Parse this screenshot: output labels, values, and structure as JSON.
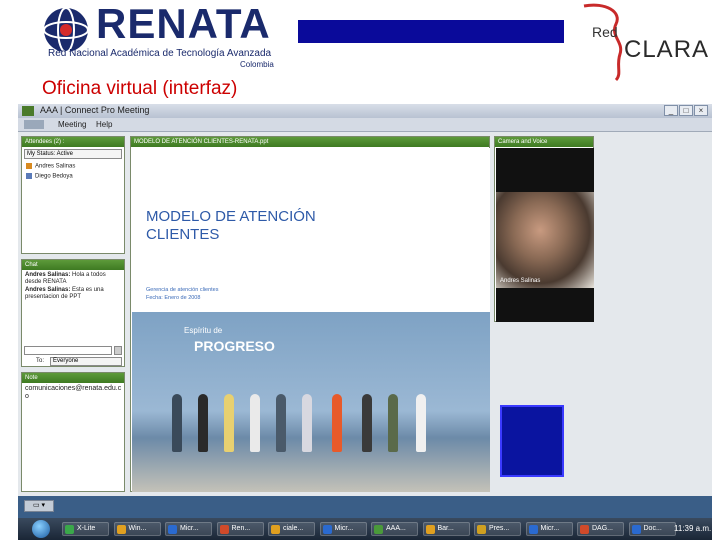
{
  "header": {
    "renata_name": "RENATA",
    "renata_subtitle": "Red Nacional Académica de Tecnología Avanzada",
    "renata_country": "Colombia",
    "redclara_red": "Red",
    "redclara_name": "CLARA",
    "title": "Oficina virtual (interfaz)",
    "colors": {
      "renata_blue": "#1a2a6c",
      "title_red": "#cc0000",
      "bar_blue": "#0a0a9a"
    }
  },
  "app": {
    "window_title": "AAA | Connect Pro Meeting",
    "menus": [
      "Meeting",
      "Help"
    ],
    "attendees": {
      "title": "Attendees (2) :",
      "status": "My Status: Active",
      "list": [
        "Andres Salinas",
        "Diego Bedoya"
      ]
    },
    "share": {
      "title": "MODELO DE ATENCIÓN CLIENTES-RENATA.ppt"
    },
    "camera": {
      "title": "Camera and Voice",
      "speaker": "Andres Salinas"
    },
    "chat": {
      "title": "Chat",
      "messages": [
        {
          "author": "Andres Salinas:",
          "text": "Hola a todos desde RENATA"
        },
        {
          "author": "Andres Salinas:",
          "text": "Esta es una presentacion de PPT"
        }
      ],
      "to_label": "To:",
      "to_value": "Everyone"
    },
    "note": {
      "title": "Note",
      "text": "comunicaciones@renata.edu.co"
    }
  },
  "slide": {
    "heading_line1": "MODELO DE ATENCIÓN",
    "heading_line2": "CLIENTES",
    "meta_line1": "Gerencia de atención clientes",
    "meta_line2": "Fecha: Enero de 2008",
    "photo_line1": "Espíritu de",
    "photo_line2": "PROGRESO"
  },
  "taskbar": {
    "items": [
      "X-Lite",
      "Win...",
      "Micr...",
      "Ren...",
      "ciale...",
      "Micr...",
      "AAA...",
      "Bar...",
      "Pres...",
      "Micr...",
      "DAG...",
      "Doc..."
    ],
    "clock": "11:39 a.m."
  }
}
